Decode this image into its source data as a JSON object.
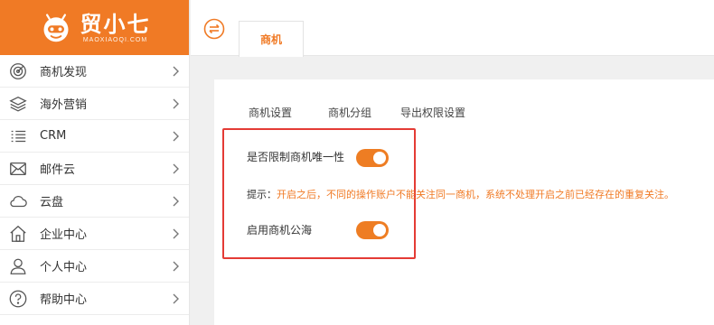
{
  "brand": {
    "name": "贸小七",
    "sub": "MAOXIAOQI.COM",
    "color": "#f07a25"
  },
  "sidebar": {
    "items": [
      {
        "label": "商机发现",
        "icon": "radar-icon"
      },
      {
        "label": "海外营销",
        "icon": "layers-icon"
      },
      {
        "label": "CRM",
        "icon": "list-icon"
      },
      {
        "label": "邮件云",
        "icon": "mail-icon"
      },
      {
        "label": "云盘",
        "icon": "cloud-icon"
      },
      {
        "label": "企业中心",
        "icon": "home-icon"
      },
      {
        "label": "个人中心",
        "icon": "user-icon"
      },
      {
        "label": "帮助中心",
        "icon": "help-icon"
      }
    ]
  },
  "topbar": {
    "tab": "商机"
  },
  "subtabs": [
    "商机设置",
    "商机分组",
    "导出权限设置"
  ],
  "settings": {
    "limit_unique_label": "是否限制商机唯一性",
    "limit_unique_on": true,
    "hint_prefix": "提示：",
    "hint_text": "开启之后，不同的操作账户不能关注同一商机，系统不处理开启之前已经存在的重复关注。",
    "public_sea_label": "启用商机公海",
    "public_sea_on": true
  },
  "colors": {
    "accent": "#f07a25",
    "switch": "#ee7d23",
    "highlight_box": "#e43b35"
  }
}
